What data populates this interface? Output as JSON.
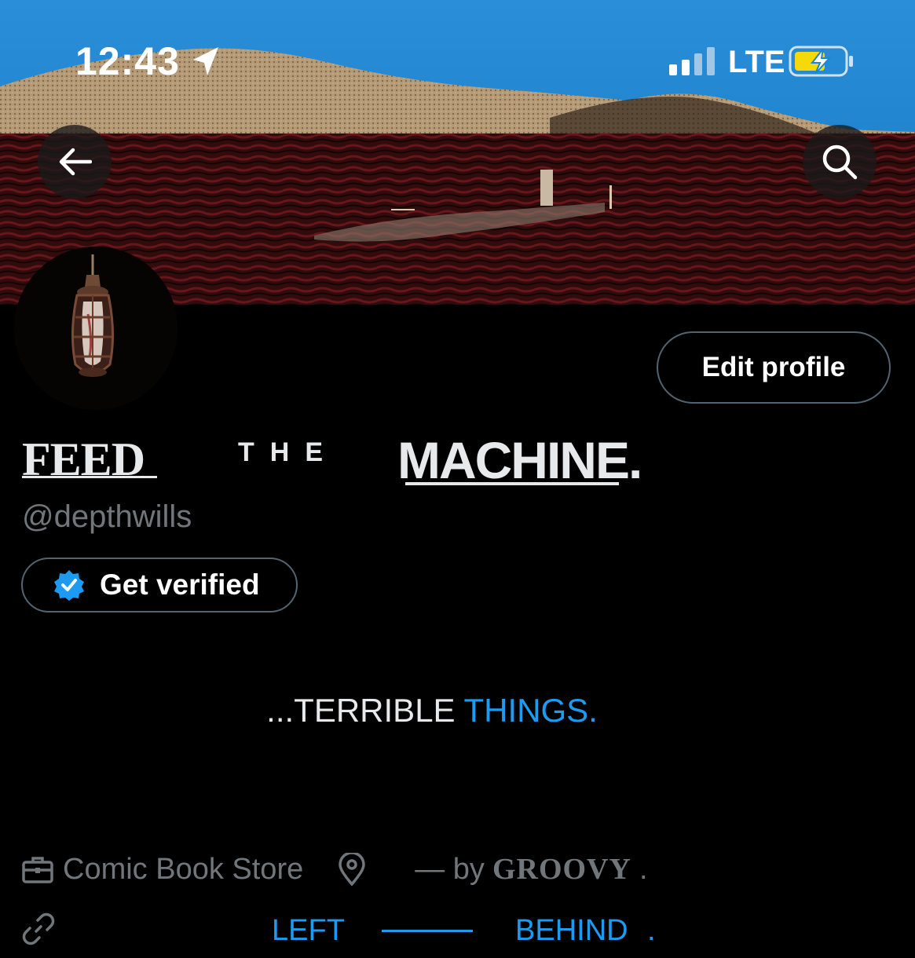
{
  "status_bar": {
    "time": "12:43",
    "network": "LTE"
  },
  "header": {
    "back_icon": "arrow-left-icon",
    "search_icon": "search-icon"
  },
  "profile": {
    "edit_label": "Edit profile",
    "name_part1": "FEED",
    "name_part2": "THE",
    "name_part3": "MACHINE.",
    "handle": "@depthwills",
    "verify_label": "Get verified",
    "bio_part1": "...TERRIBLE ",
    "bio_part2": "THINGS.",
    "category": "Comic Book Store",
    "location_text": "— by",
    "location_brand": "GROOVY",
    "location_end": ".",
    "link_part1": "LEFT",
    "link_part2": "BEHIND",
    "link_part3": "."
  },
  "colors": {
    "accent": "#1d9bf0",
    "secondary_text": "#71767b",
    "border": "#536471",
    "sky": "#1a86d4",
    "sea": "#5a1418"
  }
}
